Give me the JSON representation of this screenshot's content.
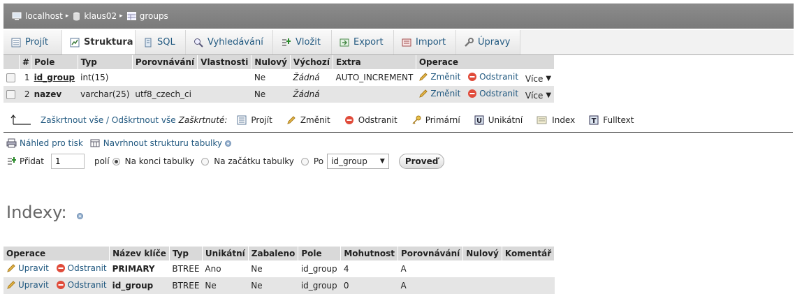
{
  "breadcrumb": {
    "server": "localhost",
    "database": "klaus02",
    "table": "groups"
  },
  "tabs": [
    {
      "label": "Projít",
      "icon": "browse-icon"
    },
    {
      "label": "Struktura",
      "icon": "structure-icon"
    },
    {
      "label": "SQL",
      "icon": "sql-icon"
    },
    {
      "label": "Vyhledávání",
      "icon": "search-icon"
    },
    {
      "label": "Vložit",
      "icon": "insert-icon"
    },
    {
      "label": "Export",
      "icon": "export-icon"
    },
    {
      "label": "Import",
      "icon": "import-icon"
    },
    {
      "label": "Úpravy",
      "icon": "wrench-icon"
    }
  ],
  "active_tab": "Struktura",
  "structure": {
    "headers": [
      "#",
      "Pole",
      "Typ",
      "Porovnávání",
      "Vlastnosti",
      "Nulový",
      "Výchozí",
      "Extra",
      "Operace"
    ],
    "rows": [
      {
        "num": "1",
        "name": "id_group",
        "type": "int(15)",
        "collation": "",
        "attributes": "",
        "null": "Ne",
        "default": "Žádná",
        "extra": "AUTO_INCREMENT"
      },
      {
        "num": "2",
        "name": "nazev",
        "type": "varchar(25)",
        "collation": "utf8_czech_ci",
        "attributes": "",
        "null": "Ne",
        "default": "Žádná",
        "extra": ""
      }
    ],
    "change_label": "Změnit",
    "drop_label": "Odstranit",
    "more_label": "Více"
  },
  "bulk": {
    "check_all": "Zaškrtnout vše",
    "separator": " / ",
    "uncheck_all": "Odškrtnout vše",
    "with_selected": "Zaškrtnuté:",
    "actions": [
      "Projít",
      "Změnit",
      "Odstranit",
      "Primární",
      "Unikátní",
      "Index",
      "Fulltext"
    ]
  },
  "print_view": "Náhled pro tisk",
  "propose_structure": "Navrhnout strukturu tabulky",
  "add": {
    "label": "Přidat",
    "count": "1",
    "fields_label": "polí",
    "opt_end": "Na konci tabulky",
    "opt_begin": "Na začátku tabulky",
    "opt_after": "Po",
    "after_value": "id_group",
    "submit": "Proveď"
  },
  "indexes": {
    "title": "Indexy:",
    "headers": [
      "Operace",
      "Název klíče",
      "Typ",
      "Unikátní",
      "Zabaleno",
      "Pole",
      "Mohutnost",
      "Porovnávání",
      "Nulový",
      "Komentář"
    ],
    "edit_label": "Upravit",
    "drop_label": "Odstranit",
    "rows": [
      {
        "key": "PRIMARY",
        "type": "BTREE",
        "unique": "Ano",
        "packed": "Ne",
        "column": "id_group",
        "cardinality": "4",
        "collation": "A",
        "null": "",
        "comment": ""
      },
      {
        "key": "id_group",
        "type": "BTREE",
        "unique": "Ne",
        "packed": "Ne",
        "column": "id_group",
        "cardinality": "0",
        "collation": "A",
        "null": "",
        "comment": ""
      }
    ]
  },
  "colors": {
    "link": "#235a81",
    "header_bg": "#d9d9d9",
    "row_alt": "#e5e5e5",
    "breadcrumb_bg": "#808080"
  }
}
